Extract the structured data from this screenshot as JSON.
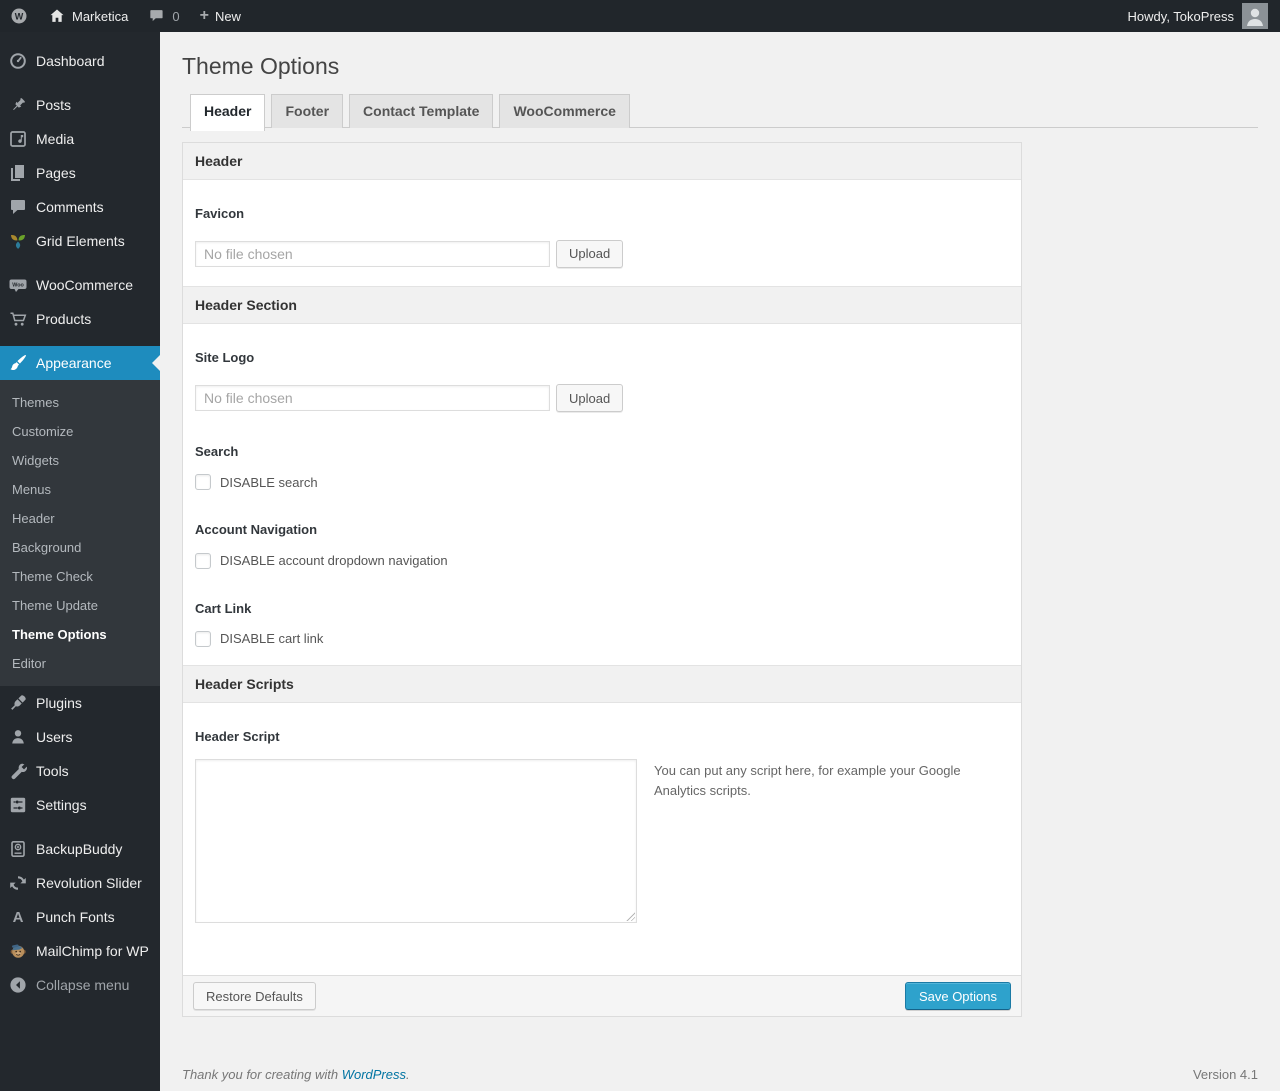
{
  "colors": {
    "menu_highlight": "#1e8cbe",
    "primary_button": "#2ea2cc",
    "link": "#0074a2"
  },
  "admin_bar": {
    "site_name": "Marketica",
    "comment_count": "0",
    "new_label": "New",
    "howdy": "Howdy, TokoPress"
  },
  "sidebar": {
    "items": [
      {
        "label": "Dashboard"
      },
      {
        "label": "Posts"
      },
      {
        "label": "Media"
      },
      {
        "label": "Pages"
      },
      {
        "label": "Comments"
      },
      {
        "label": "Grid Elements"
      },
      {
        "label": "WooCommerce"
      },
      {
        "label": "Products"
      },
      {
        "label": "Appearance"
      },
      {
        "label": "Plugins"
      },
      {
        "label": "Users"
      },
      {
        "label": "Tools"
      },
      {
        "label": "Settings"
      },
      {
        "label": "BackupBuddy"
      },
      {
        "label": "Revolution Slider"
      },
      {
        "label": "Punch Fonts"
      },
      {
        "label": "MailChimp for WP"
      }
    ],
    "appearance_submenu": [
      "Themes",
      "Customize",
      "Widgets",
      "Menus",
      "Header",
      "Background",
      "Theme Check",
      "Theme Update",
      "Theme Options",
      "Editor"
    ],
    "current_submenu_item": "Theme Options",
    "collapse_label": "Collapse menu"
  },
  "page": {
    "title": "Theme Options",
    "tabs": [
      "Header",
      "Footer",
      "Contact Template",
      "WooCommerce"
    ],
    "active_tab": "Header"
  },
  "panel": {
    "section_header_title": "Header",
    "favicon": {
      "label": "Favicon",
      "value": "",
      "placeholder": "No file chosen",
      "upload_label": "Upload"
    },
    "section_header_section_title": "Header Section",
    "site_logo": {
      "label": "Site Logo",
      "value": "",
      "placeholder": "No file chosen",
      "upload_label": "Upload"
    },
    "search": {
      "label": "Search",
      "checkbox_label": "DISABLE search",
      "checked": false
    },
    "account_navigation": {
      "label": "Account Navigation",
      "checkbox_label": "DISABLE account dropdown navigation",
      "checked": false
    },
    "cart_link": {
      "label": "Cart Link",
      "checkbox_label": "DISABLE cart link",
      "checked": false
    },
    "section_header_scripts_title": "Header Scripts",
    "header_script": {
      "label": "Header Script",
      "value": "",
      "description": "You can put any script here, for example your Google Analytics scripts."
    },
    "footer": {
      "restore_label": "Restore Defaults",
      "save_label": "Save Options"
    }
  },
  "page_footer": {
    "thanks_text": "Thank you for creating with",
    "wordpress_label": "WordPress",
    "suffix": ".",
    "version": "Version 4.1"
  }
}
